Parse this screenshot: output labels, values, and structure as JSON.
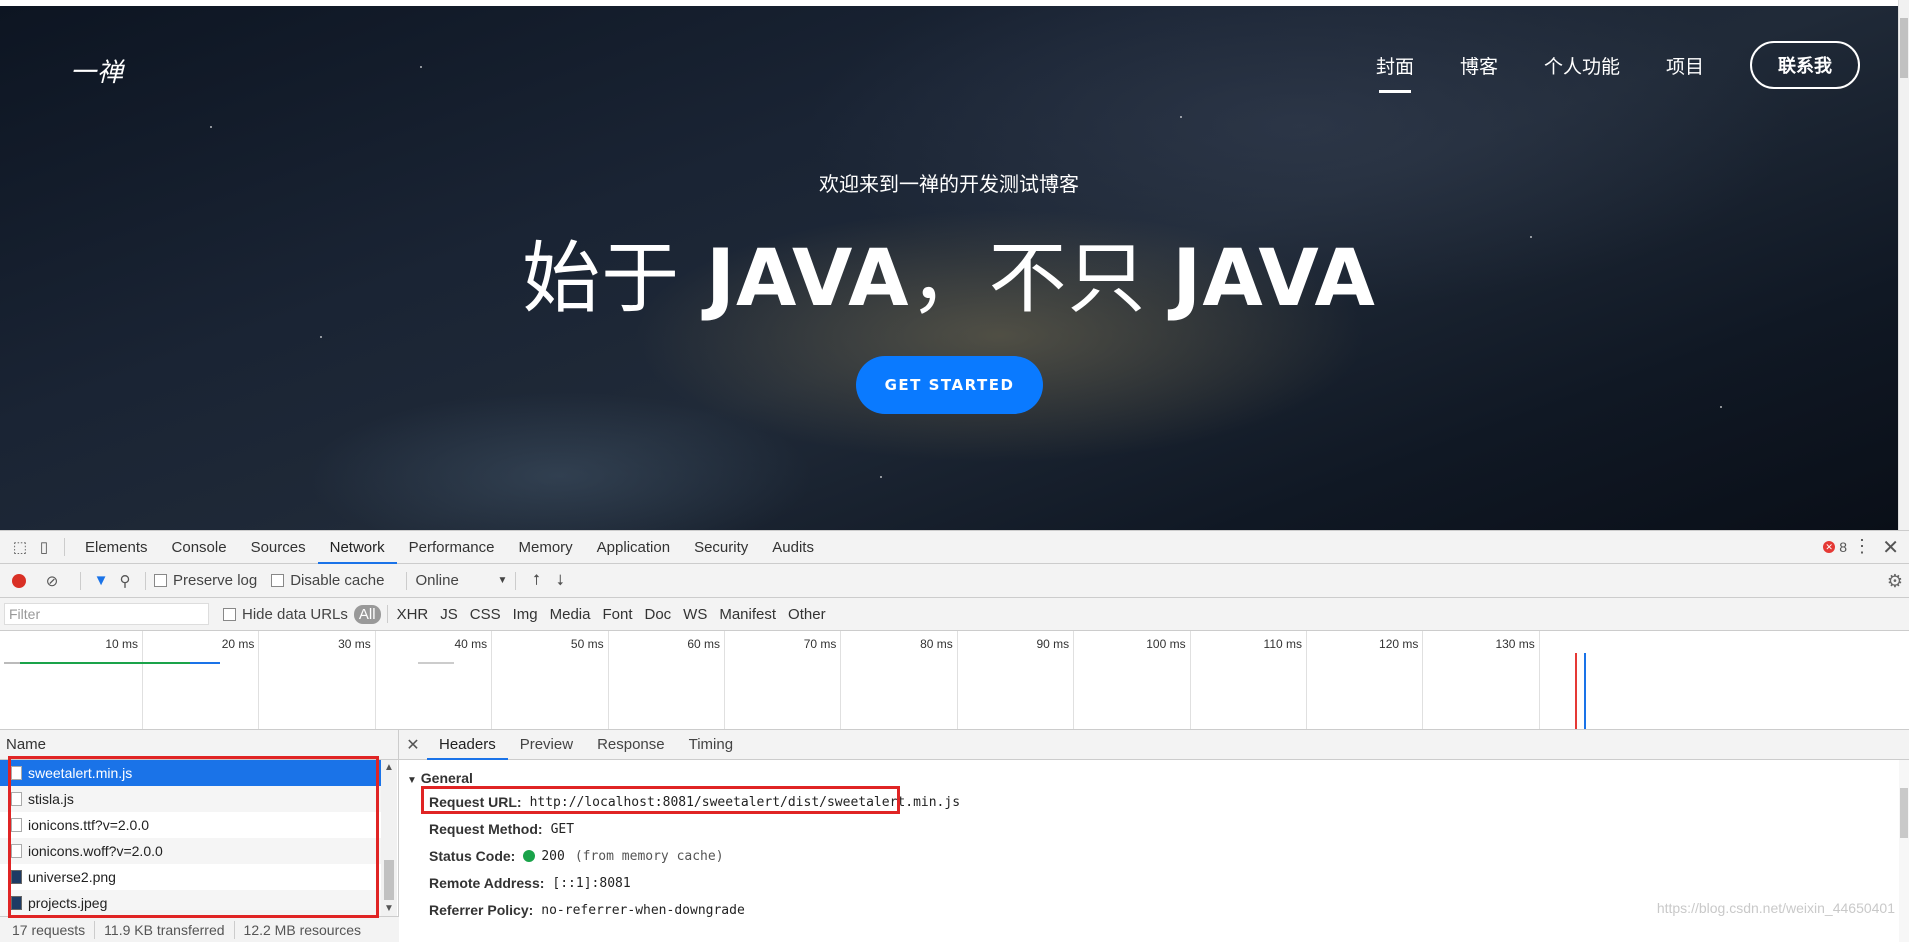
{
  "site": {
    "logo": "一禅",
    "nav": [
      "封面",
      "博客",
      "个人功能",
      "项目"
    ],
    "contact": "联系我",
    "subtitle": "欢迎来到一禅的开发测试博客",
    "title_part1": "始于 ",
    "title_java1": "JAVA",
    "title_part2": "，不只 ",
    "title_java2": "JAVA",
    "cta": "GET STARTED"
  },
  "devtools": {
    "tabs": [
      "Elements",
      "Console",
      "Sources",
      "Network",
      "Performance",
      "Memory",
      "Application",
      "Security",
      "Audits"
    ],
    "active_tab": "Network",
    "error_count": "8",
    "toolbar": {
      "preserve_log": "Preserve log",
      "disable_cache": "Disable cache",
      "throttle": "Online"
    },
    "filter": {
      "placeholder": "Filter",
      "hide_data_urls": "Hide data URLs",
      "types": [
        "All",
        "XHR",
        "JS",
        "CSS",
        "Img",
        "Media",
        "Font",
        "Doc",
        "WS",
        "Manifest",
        "Other"
      ]
    },
    "timeline_ticks": [
      "10 ms",
      "20 ms",
      "30 ms",
      "40 ms",
      "50 ms",
      "60 ms",
      "70 ms",
      "80 ms",
      "90 ms",
      "100 ms",
      "110 ms",
      "120 ms",
      "130 ms"
    ],
    "requests": {
      "header": "Name",
      "items": [
        {
          "name": "sweetalert.min.js",
          "type": "script"
        },
        {
          "name": "stisla.js",
          "type": "script"
        },
        {
          "name": "ionicons.ttf?v=2.0.0",
          "type": "font"
        },
        {
          "name": "ionicons.woff?v=2.0.0",
          "type": "font"
        },
        {
          "name": "universe2.png",
          "type": "image"
        },
        {
          "name": "projects.jpeg",
          "type": "image"
        }
      ],
      "status": {
        "count": "17 requests",
        "transferred": "11.9 KB transferred",
        "resources": "12.2 MB resources"
      }
    },
    "details": {
      "tabs": [
        "Headers",
        "Preview",
        "Response",
        "Timing"
      ],
      "section": "General",
      "request_url_label": "Request URL:",
      "request_url": "http://localhost:8081/sweetalert/dist/sweetalert.min.js",
      "method_label": "Request Method:",
      "method": "GET",
      "status_label": "Status Code:",
      "status": "200",
      "status_note": "(from memory cache)",
      "remote_label": "Remote Address:",
      "remote": "[::1]:8081",
      "referrer_label": "Referrer Policy:",
      "referrer": "no-referrer-when-downgrade"
    },
    "watermark": "https://blog.csdn.net/weixin_44650401"
  },
  "colors": {
    "accent": "#0a7aff",
    "devtools_blue": "#1a73e8",
    "highlight": "#e02424"
  }
}
